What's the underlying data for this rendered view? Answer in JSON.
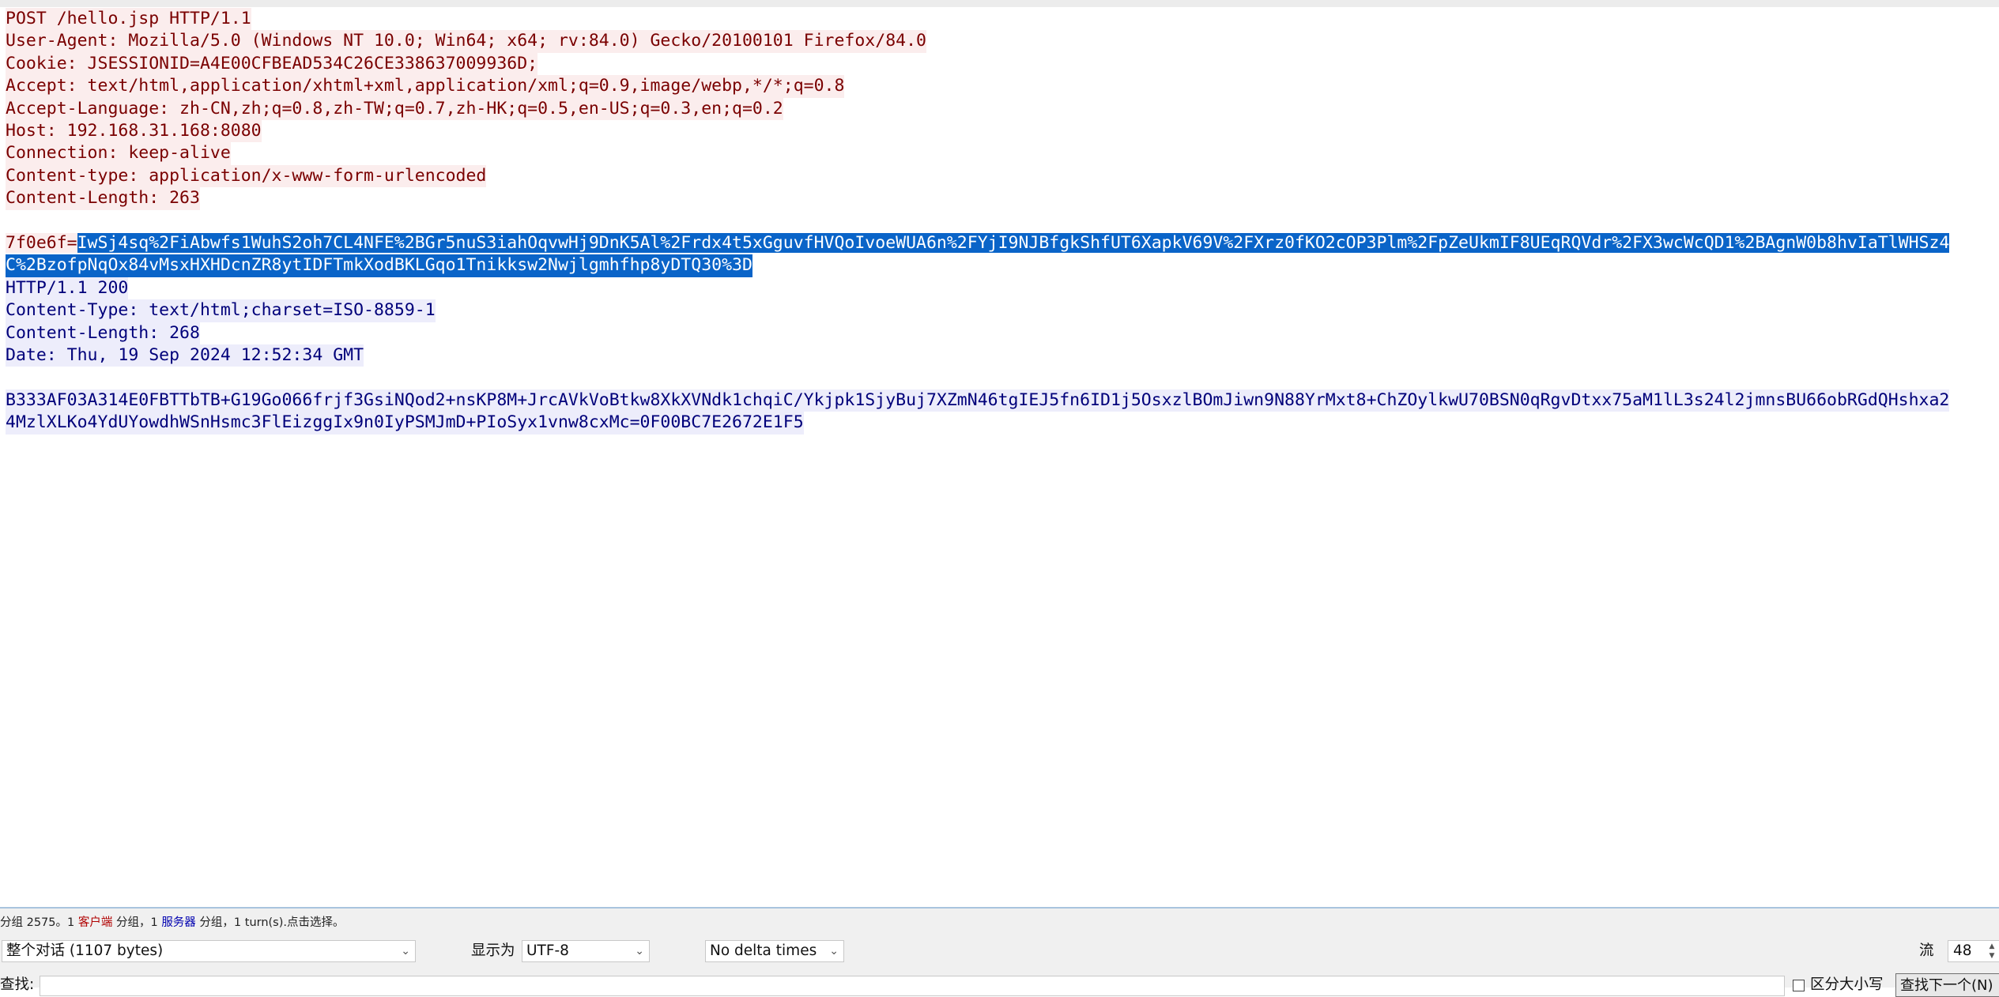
{
  "stream": {
    "request_headers": [
      "POST /hello.jsp HTTP/1.1",
      "User-Agent: Mozilla/5.0 (Windows NT 10.0; Win64; x64; rv:84.0) Gecko/20100101 Firefox/84.0",
      "Cookie: JSESSIONID=A4E00CFBEAD534C26CE338637009936D;",
      "Accept: text/html,application/xhtml+xml,application/xml;q=0.9,image/webp,*/*;q=0.8",
      "Accept-Language: zh-CN,zh;q=0.8,zh-TW;q=0.7,zh-HK;q=0.5,en-US;q=0.3,en;q=0.2",
      "Host: 192.168.31.168:8080",
      "Connection: keep-alive",
      "Content-type: application/x-www-form-urlencoded",
      "Content-Length: 263"
    ],
    "request_body_key": "7f0e6f=",
    "request_body_selected_line1": "IwSj4sq%2FiAbwfs1WuhS2oh7CL4NFE%2BGr5nuS3iahOqvwHj9DnK5Al%2Frdx4t5xGguvfHVQoIvoeWUA6n%2FYjI9NJBfgkShfUT6XapkV69V%2FXrz0fKO2cOP3Plm%2FpZeUkmIF8UEqRQVdr%2FX3wcWcQD1%2BAgnW0b8hvIaTlWHSz4",
    "request_body_selected_line2": "C%2BzofpNqOx84vMsxHXHDcnZR8ytIDFTmkXodBKLGqo1Tnikksw2Nwjlgmhfhp8yDTQ30%3D",
    "response_headers": [
      "HTTP/1.1 200",
      "Content-Type: text/html;charset=ISO-8859-1",
      "Content-Length: 268",
      "Date: Thu, 19 Sep 2024 12:52:34 GMT"
    ],
    "response_body_line1": "B333AF03A314E0FBTTbTB+G19Go066frjf3GsiNQod2+nsKP8M+JrcAVkVoBtkw8XkXVNdk1chqiC/Ykjpk1SjyBuj7XZmN46tgIEJ5fn6ID1j5OsxzlBOmJiwn9N88YrMxt8+ChZOylkwU70BSN0qRgvDtxx75aM1lL3s24l2jmnsBU66obRGdQHshxa2",
    "response_body_line2": "4MzlXLKo4YdUYowdhWSnHsmc3FlEizggIx9n0IyPSMJmD+PIoSyx1vnw8cxMc=0F00BC7E2672E1F5"
  },
  "status": {
    "part1": "分组 2575。1 ",
    "client_label": "客户端",
    "part2": " 分组，1 ",
    "server_label": "服务器",
    "part3": " 分组，1 turn(s).点击选择。"
  },
  "controls": {
    "conversation_select": "整个对话 (1107 bytes)",
    "show_as_label": "显示为",
    "encoding_select": "UTF-8",
    "delta_select": "No delta times",
    "stream_label": "流",
    "stream_value": "48",
    "find_label": "查找:",
    "case_label": "区分大小写",
    "find_next_label": "查找下一个(N)"
  },
  "colors": {
    "client_text": "#7a0000",
    "client_bg": "#fbeded",
    "server_text": "#00007a",
    "server_bg": "#ededfb",
    "selection_bg": "#0a64c8"
  }
}
